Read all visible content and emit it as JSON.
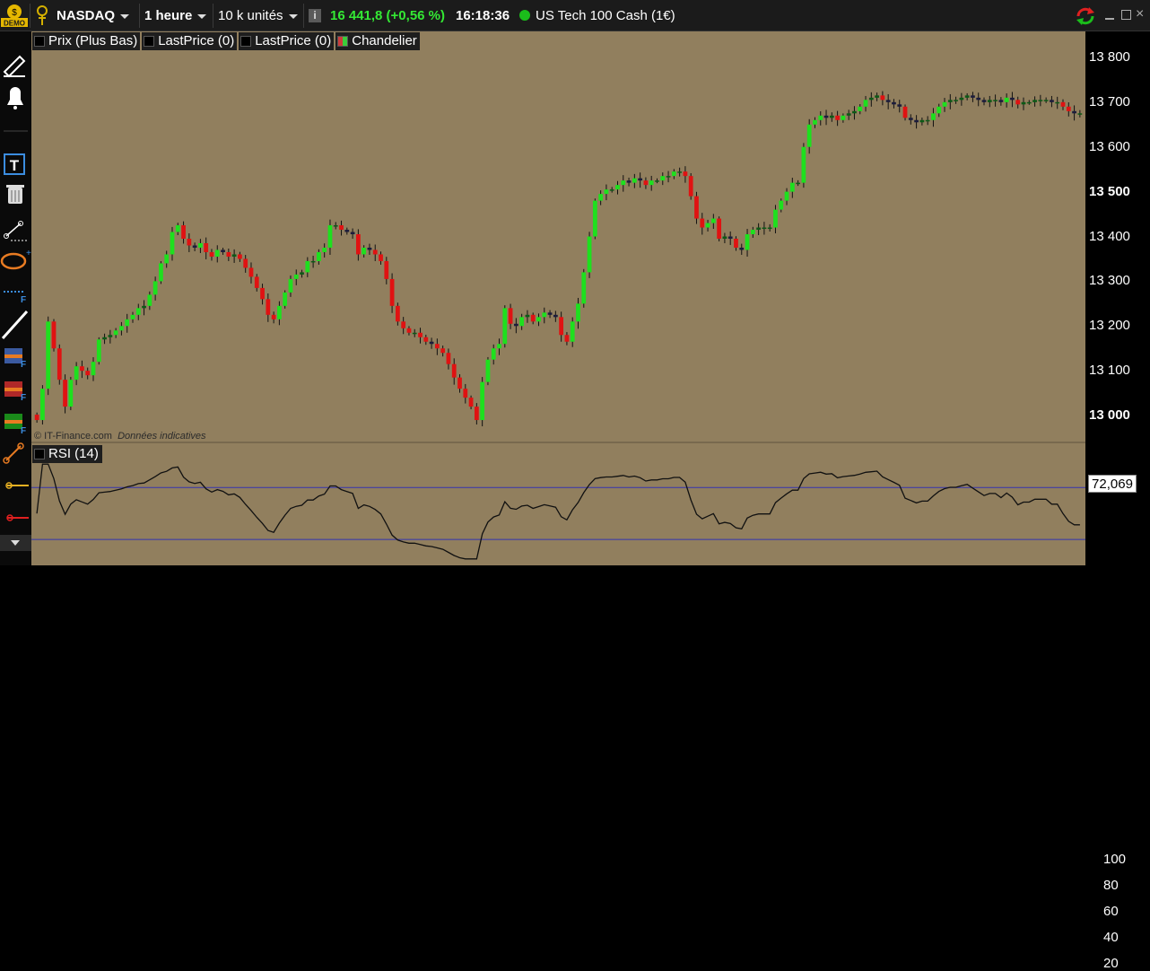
{
  "toolbar": {
    "instrument": "NASDAQ",
    "timeframe": "1 heure",
    "units": "10 k unités",
    "price_change": "16 441,8 (+0,56 %)",
    "time": "16:18:36",
    "description": "US Tech 100 Cash (1€)",
    "demo_badge": "DEMO"
  },
  "colors": {
    "chart_bg": "#917f5e",
    "bull": "#1ee01e",
    "bull_dark": "#0c5a16",
    "bear": "#e01212",
    "bear_dark": "#1c1c3c",
    "rsi_band": "#3434b0"
  },
  "legend": {
    "items": [
      {
        "label": "Prix (Plus Bas)",
        "swatch": "#000000"
      },
      {
        "label": "LastPrice (0)",
        "swatch": "#000000"
      },
      {
        "label": "LastPrice (0)",
        "swatch": "#000000"
      },
      {
        "label": "Chandelier",
        "swatch": "#cc3b3b"
      }
    ],
    "rsi": "RSI (14)"
  },
  "watermark": {
    "source": "© IT-Finance.com",
    "note": "Données indicatives"
  },
  "sidebar_icons": [
    "pencil-icon",
    "bell-icon",
    "text-icon",
    "trash-icon",
    "line-icon",
    "ellipse-icon",
    "horizontal-line-icon",
    "trendline-icon",
    "fibonacci-icon",
    "channel-icon",
    "fan-icon",
    "segment-icon",
    "hline-icon",
    "ray-icon",
    "scroll-down-icon"
  ],
  "chart_data": [
    {
      "type": "candlestick",
      "ylim": [
        12940,
        13850
      ],
      "y_ticks": [
        "13 800",
        "13 700",
        "13 600",
        "13 500",
        "13 400",
        "13 300",
        "13 200",
        "13 100",
        "13 000"
      ],
      "y_tick_values": [
        13800,
        13700,
        13600,
        13500,
        13400,
        13300,
        13200,
        13100,
        13000
      ],
      "bold_ticks": [
        "13 500",
        "13 000"
      ],
      "close": [
        12990,
        13060,
        13210,
        13150,
        13080,
        13020,
        13080,
        13110,
        13100,
        13090,
        13120,
        13170,
        13175,
        13180,
        13190,
        13200,
        13215,
        13225,
        13240,
        13245,
        13270,
        13300,
        13340,
        13360,
        13410,
        13425,
        13395,
        13380,
        13375,
        13385,
        13365,
        13355,
        13370,
        13365,
        13355,
        13360,
        13350,
        13330,
        13310,
        13285,
        13260,
        13225,
        13215,
        13245,
        13275,
        13305,
        13315,
        13320,
        13345,
        13345,
        13365,
        13375,
        13425,
        13425,
        13415,
        13410,
        13405,
        13360,
        13375,
        13370,
        13360,
        13345,
        13305,
        13245,
        13210,
        13195,
        13185,
        13185,
        13175,
        13165,
        13160,
        13150,
        13140,
        13115,
        13085,
        13060,
        13040,
        13020,
        12990,
        13075,
        13125,
        13150,
        13160,
        13240,
        13205,
        13200,
        13220,
        13225,
        13210,
        13220,
        13230,
        13225,
        13220,
        13180,
        13165,
        13210,
        13250,
        13320,
        13400,
        13480,
        13495,
        13505,
        13505,
        13515,
        13525,
        13520,
        13530,
        13525,
        13515,
        13525,
        13525,
        13535,
        13535,
        13545,
        13545,
        13535,
        13490,
        13440,
        13420,
        13430,
        13440,
        13395,
        13400,
        13395,
        13375,
        13370,
        13405,
        13415,
        13420,
        13420,
        13420,
        13460,
        13480,
        13500,
        13520,
        13520,
        13600,
        13650,
        13660,
        13670,
        13665,
        13670,
        13660,
        13670,
        13675,
        13680,
        13690,
        13705,
        13710,
        13715,
        13705,
        13700,
        13695,
        13690,
        13665,
        13660,
        13655,
        13660,
        13660,
        13675,
        13690,
        13700,
        13705,
        13705,
        13710,
        13715,
        13710,
        13705,
        13700,
        13705,
        13705,
        13700,
        13710,
        13705,
        13695,
        13700,
        13700,
        13705,
        13705,
        13705,
        13700,
        13700,
        13690,
        13680,
        13675,
        13675
      ]
    },
    {
      "type": "line",
      "series": [
        {
          "name": "RSI (14)"
        }
      ],
      "ylim": [
        10,
        102
      ],
      "y_ticks": [
        "100",
        "80",
        "60",
        "40",
        "20"
      ],
      "y_tick_values": [
        100,
        80,
        60,
        40,
        20
      ],
      "levels": [
        70,
        30
      ],
      "current_value": "72,069"
    }
  ]
}
